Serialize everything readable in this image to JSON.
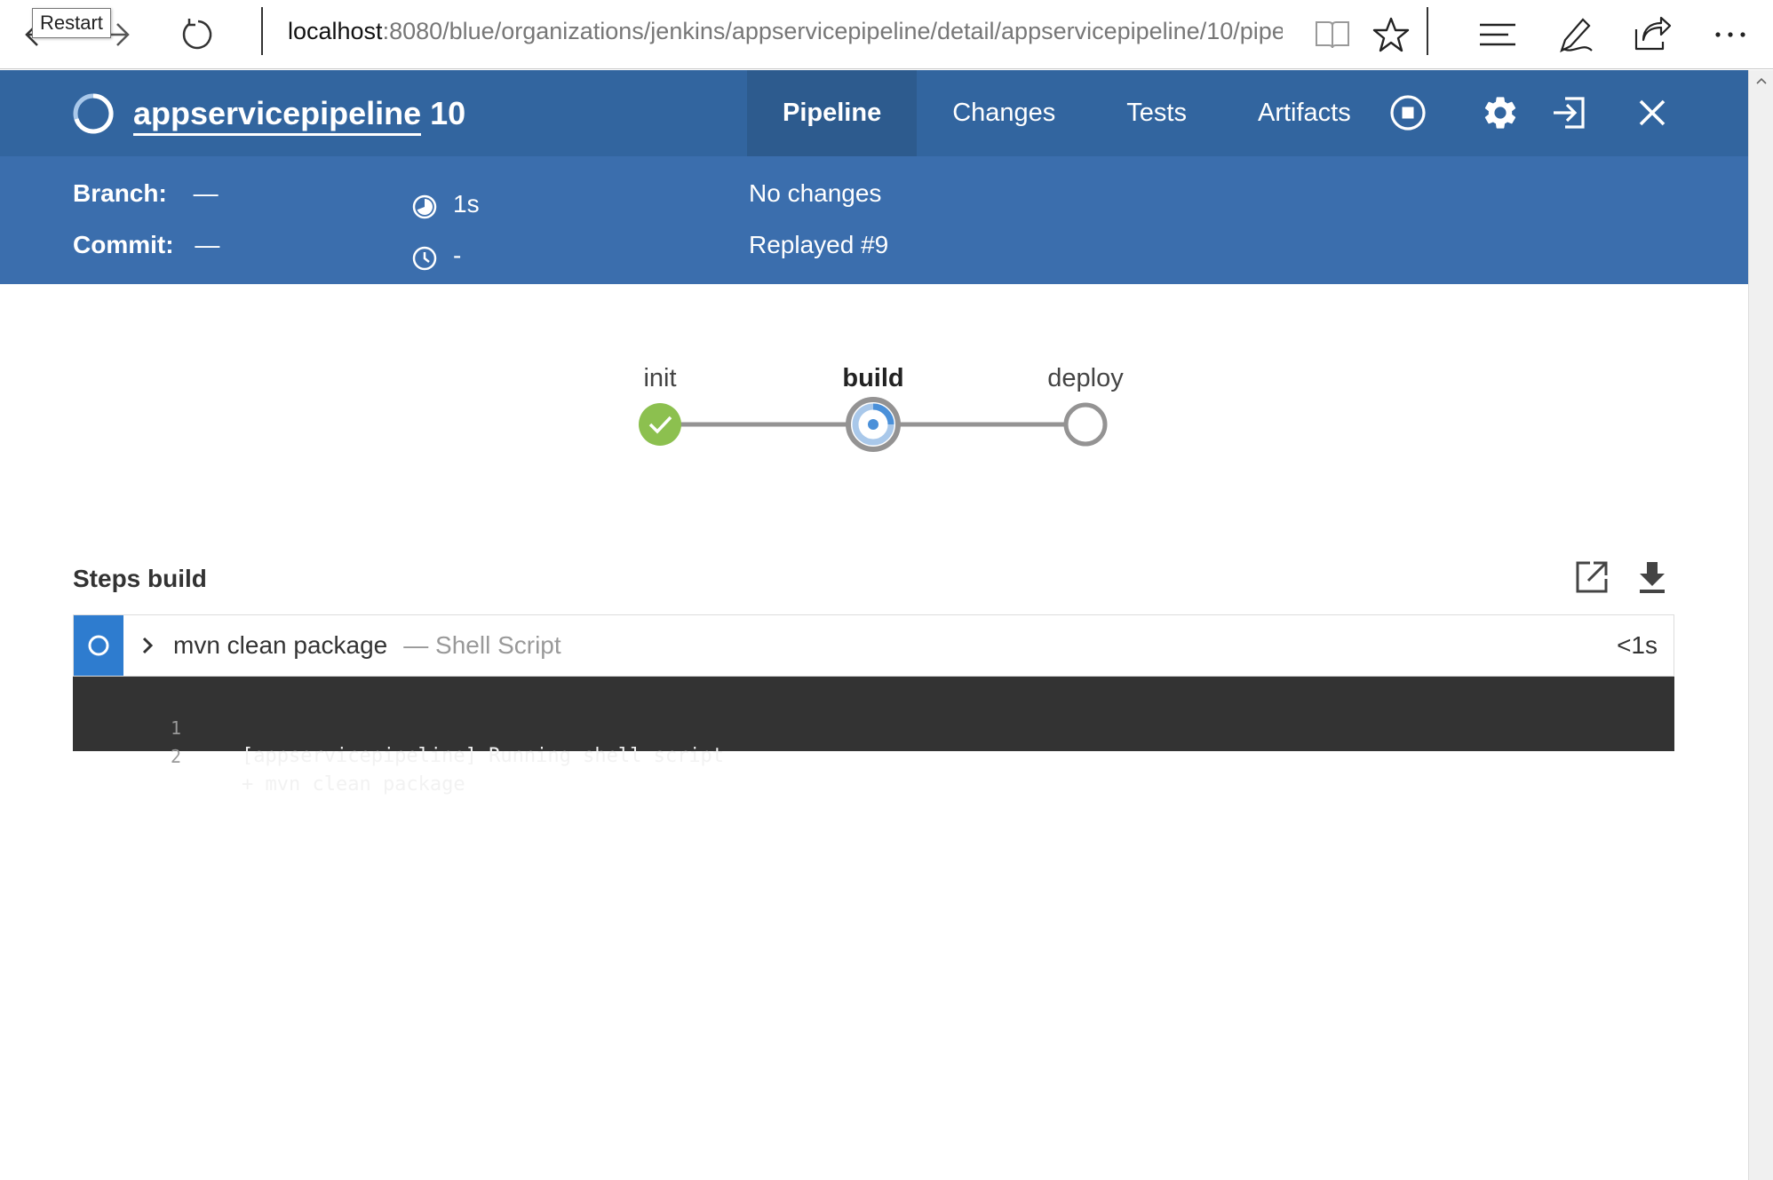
{
  "browser": {
    "tooltip": "Restart",
    "url_host": "localhost",
    "url_path": ":8080/blue/organizations/jenkins/appservicepipeline/detail/appservicepipeline/10/pipeline"
  },
  "header": {
    "job_name": "appservicepipeline",
    "run_number": "10",
    "tabs": [
      {
        "label": "Pipeline",
        "active": true
      },
      {
        "label": "Changes",
        "active": false
      },
      {
        "label": "Tests",
        "active": false
      },
      {
        "label": "Artifacts",
        "active": false
      }
    ]
  },
  "summary": {
    "branch_label": "Branch:",
    "branch_value": "—",
    "commit_label": "Commit:",
    "commit_value": "—",
    "duration": "1s",
    "started": "-",
    "changes": "No changes",
    "cause": "Replayed #9"
  },
  "pipeline": {
    "stages": [
      {
        "name": "init",
        "status": "success"
      },
      {
        "name": "build",
        "status": "running"
      },
      {
        "name": "deploy",
        "status": "not_built"
      }
    ]
  },
  "steps": {
    "title": "Steps build",
    "items": [
      {
        "name": "mvn clean package",
        "type": "— Shell Script",
        "duration": "<1s",
        "log": [
          {
            "num": "1",
            "text": "[appservicepipeline] Running shell script"
          },
          {
            "num": "2",
            "text": "+ mvn clean package"
          }
        ]
      }
    ]
  },
  "colors": {
    "header": "#32659f",
    "summary": "#3b6ead",
    "active_tab": "#2d5b8e",
    "success": "#8cc04f",
    "running": "#4a90d9",
    "step_status": "#2e7ccf",
    "log_bg": "#333333"
  }
}
